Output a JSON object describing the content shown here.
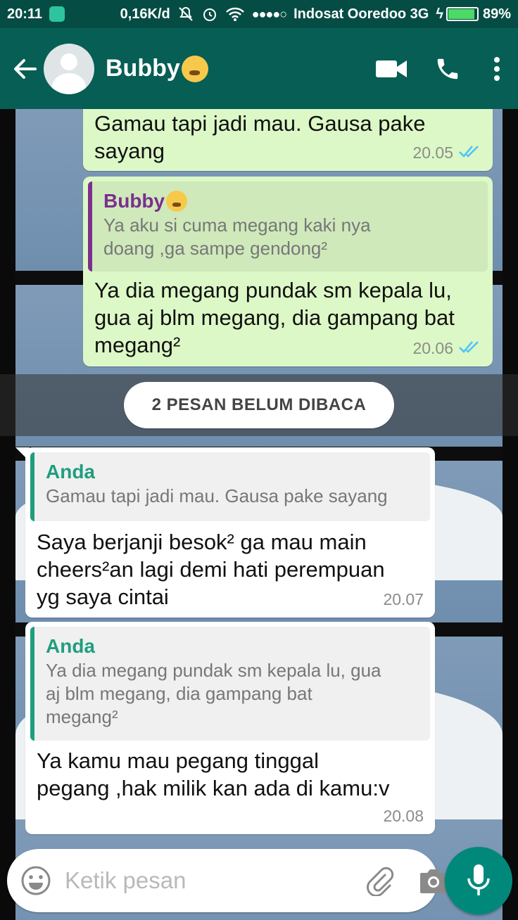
{
  "status_bar": {
    "time": "20:11",
    "speed": "0,16K/d",
    "signal_dots": "●●●●○",
    "carrier": "Indosat Ooredoo 3G",
    "charge_symbol": "ϟ",
    "battery": "89%",
    "battery_level": 0.89
  },
  "header": {
    "contact_name": "Bubby"
  },
  "messages": [
    {
      "text_1": "Gamau tapi jadi mau. Gausa pake",
      "text_2": "sayang",
      "time": "20.05"
    },
    {
      "quote_name": "Bubby",
      "quote_1": "Ya aku si cuma megang kaki nya",
      "quote_2": "doang ,ga sampe gendong²",
      "text_1": "Ya dia megang pundak sm kepala lu,",
      "text_2": "gua aj blm megang, dia gampang bat",
      "text_3": "megang²",
      "time": "20.06"
    },
    {
      "quote_name": "Anda",
      "quote_1": "Gamau tapi jadi mau. Gausa pake sayang",
      "text_1": "Saya berjanji besok² ga mau main",
      "text_2": "cheers²an lagi demi hati perempuan",
      "text_3": "yg saya cintai",
      "time": "20.07"
    },
    {
      "quote_name": "Anda",
      "quote_1": "Ya dia megang pundak sm kepala lu, gua",
      "quote_2": "aj blm megang, dia gampang bat",
      "quote_3": "megang²",
      "text_1": "Ya kamu mau pegang tinggal",
      "text_2": "pegang ,hak milik kan ada di kamu:v",
      "time": "20.08"
    }
  ],
  "unread_label": "2 PESAN BELUM DIBACA",
  "input": {
    "placeholder": "Ketik pesan"
  },
  "colors": {
    "header": "#075e54",
    "status_bar": "#054d44",
    "outgoing_bubble": "#dcf8c6",
    "incoming_bubble": "#ffffff",
    "read_ticks": "#4fc3f7",
    "mic_button": "#00897b"
  },
  "icons": [
    "back-arrow-icon",
    "avatar",
    "video-call-icon",
    "phone-icon",
    "more-options-icon",
    "emoji-icon",
    "attach-icon",
    "camera-icon",
    "mic-icon"
  ]
}
